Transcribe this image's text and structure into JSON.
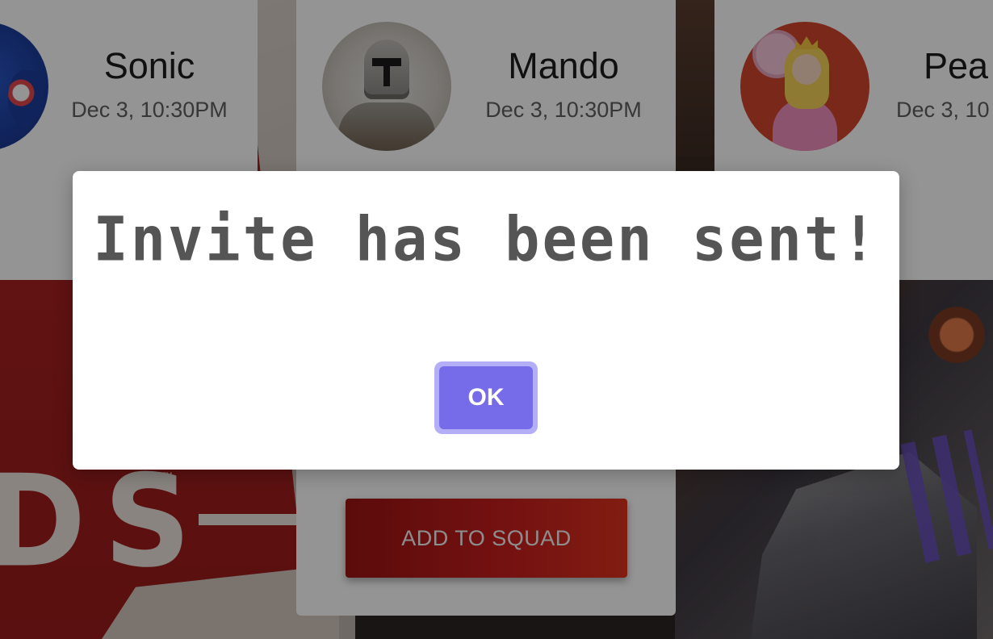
{
  "cards": [
    {
      "name": "Sonic",
      "time": "Dec 3, 10:30PM"
    },
    {
      "name": "Mando",
      "time": "Dec 3, 10:30PM"
    },
    {
      "name": "Pea",
      "time": "Dec 3, 10"
    }
  ],
  "background": {
    "art_text": "DS",
    "art_tm": "™"
  },
  "squad_button_label": "ADD TO SQUAD",
  "modal": {
    "title": "Invite has been sent!",
    "ok_label": "OK"
  },
  "colors": {
    "ok_button": "#766be9",
    "ok_focus_ring": "#b3aef5",
    "add_button": "#c81e1e",
    "modal_title": "#555555",
    "overlay": "rgba(0,0,0,0.42)"
  },
  "icons": [
    "sonic-avatar",
    "mando-avatar",
    "peach-avatar"
  ]
}
